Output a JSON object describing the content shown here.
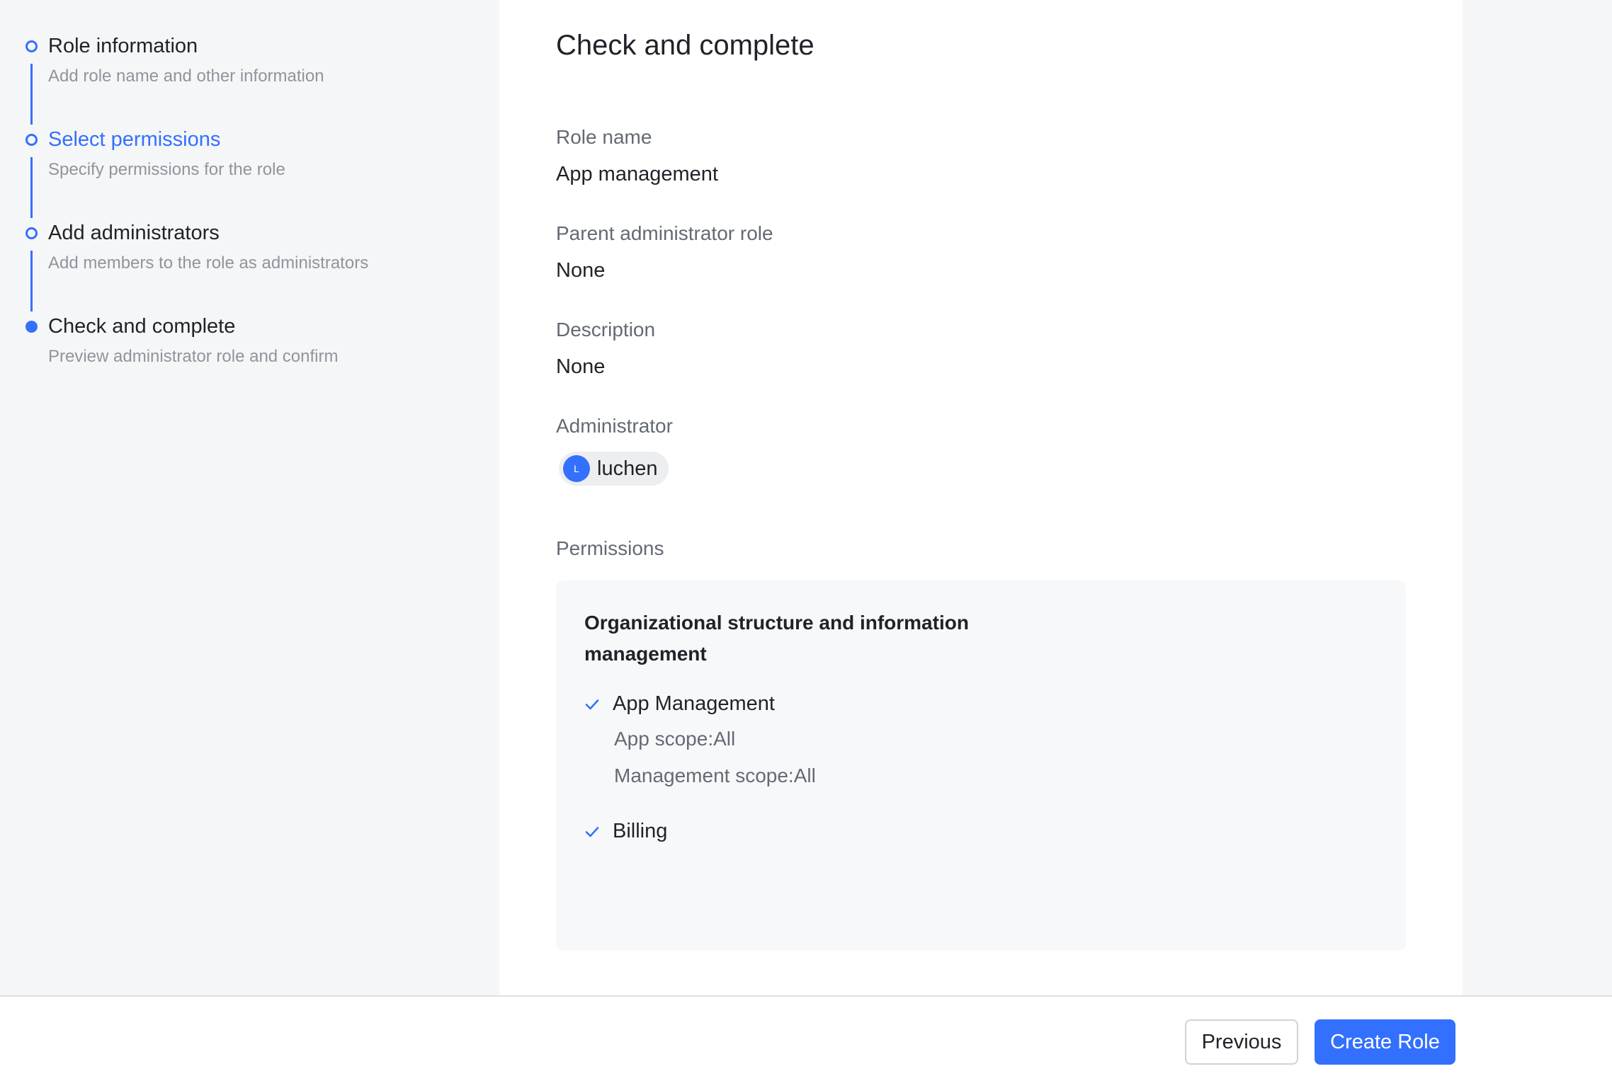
{
  "steps": [
    {
      "title": "Role information",
      "subtitle": "Add role name and other information",
      "state": "done"
    },
    {
      "title": "Select permissions",
      "subtitle": "Specify permissions for the role",
      "state": "link"
    },
    {
      "title": "Add administrators",
      "subtitle": "Add members to the role as administrators",
      "state": "done"
    },
    {
      "title": "Check and complete",
      "subtitle": "Preview administrator role and confirm",
      "state": "current"
    }
  ],
  "main": {
    "heading": "Check and complete",
    "role_name_label": "Role name",
    "role_name_value": "App management",
    "parent_role_label": "Parent administrator role",
    "parent_role_value": "None",
    "description_label": "Description",
    "description_value": "None",
    "administrator_label": "Administrator",
    "administrator": {
      "initial": "L",
      "name": "luchen"
    },
    "permissions_label": "Permissions",
    "permissions": {
      "group_title": "Organizational structure and information management",
      "items": [
        {
          "label": "App Management",
          "details": [
            "App scope:All",
            "Management scope:All"
          ]
        },
        {
          "label": "Billing",
          "details": []
        }
      ]
    }
  },
  "footer": {
    "previous_label": "Previous",
    "create_label": "Create Role"
  },
  "colors": {
    "accent": "#3370ff",
    "sidebar_bg": "#f5f6f7",
    "text_primary": "#1f2329",
    "text_secondary": "#646a73"
  }
}
